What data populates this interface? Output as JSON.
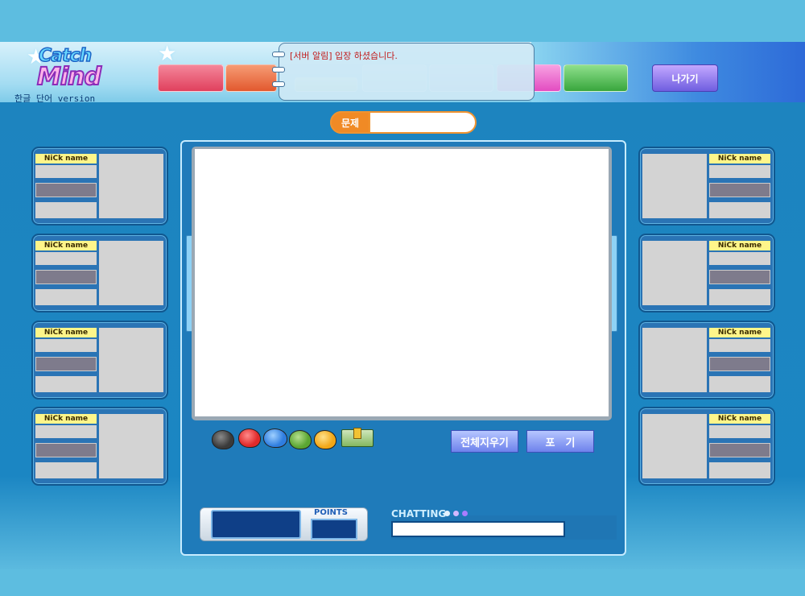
{
  "header": {
    "logo_top": "Catch",
    "logo_bottom": "Mind",
    "subtitle": "한글 단어 version",
    "notice": "[서버 알림] 입장 하셨습니다.",
    "exit_label": "나가기",
    "tab_colors": [
      "#e8526b",
      "#ea6a42",
      "#bfe3c4",
      "#c7e4ee",
      "#c6d1f0",
      "#e85bc6",
      "#47b74a"
    ]
  },
  "question": {
    "label": "문제",
    "value": ""
  },
  "players": {
    "nick_label": "NiCk name",
    "left": [
      {},
      {},
      {},
      {}
    ],
    "right": [
      {},
      {},
      {},
      {}
    ]
  },
  "palette": {
    "colors": [
      {
        "name": "black",
        "hex": "#3a3a3a"
      },
      {
        "name": "red",
        "hex": "#e02a2a"
      },
      {
        "name": "blue",
        "hex": "#2f7ee0"
      },
      {
        "name": "green",
        "hex": "#5aa632"
      },
      {
        "name": "yellow",
        "hex": "#f2a717"
      }
    ],
    "eraser": "eraser-icon"
  },
  "buttons": {
    "clear_all": "전체지우기",
    "give_up": "포　기"
  },
  "bottom": {
    "points_label": "POINTS",
    "chatting_label": "CHATTING",
    "chat_input_value": ""
  }
}
